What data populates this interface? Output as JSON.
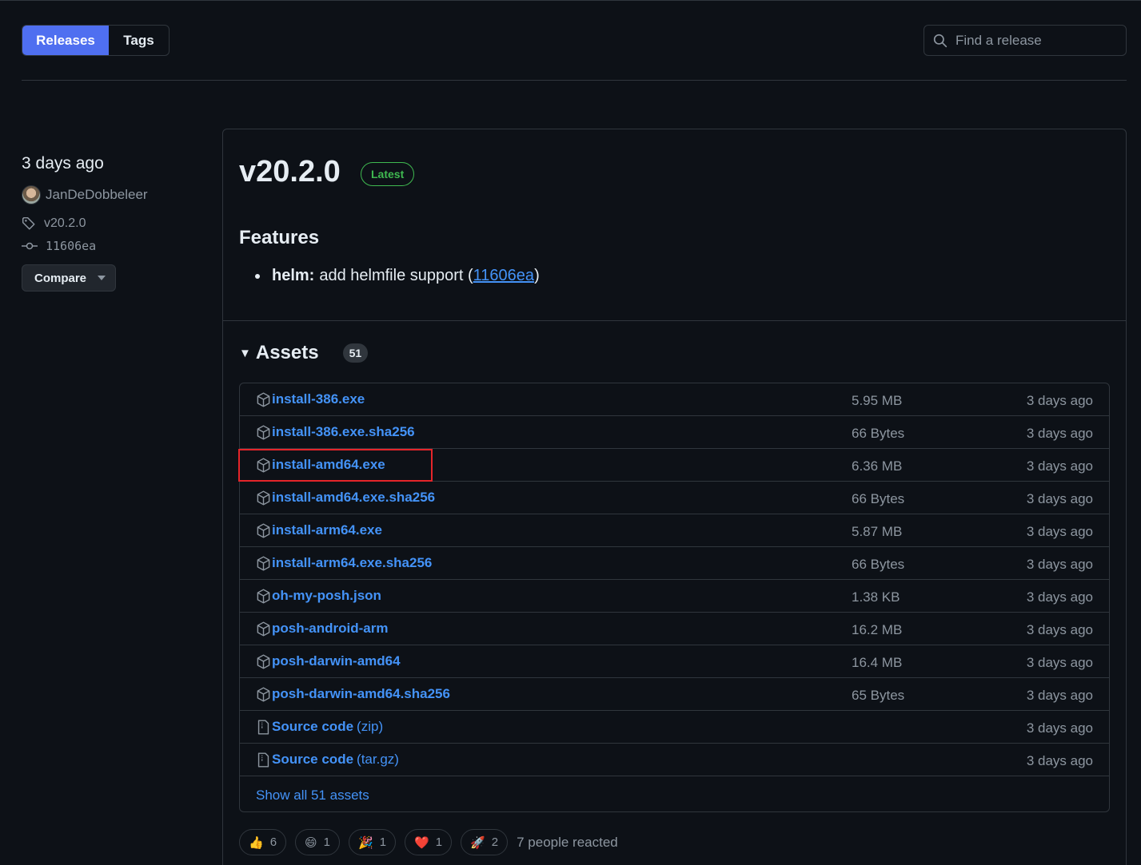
{
  "nav": {
    "releases_label": "Releases",
    "tags_label": "Tags",
    "search_placeholder": "Find a release"
  },
  "meta": {
    "time": "3 days ago",
    "author": "JanDeDobbeleer",
    "tag": "v20.2.0",
    "commit": "11606ea",
    "compare_label": "Compare"
  },
  "release": {
    "title": "v20.2.0",
    "badge": "Latest",
    "features_heading": "Features",
    "feature_scope": "helm:",
    "feature_text": "add helmfile support (",
    "feature_link": "11606ea",
    "feature_close": ")"
  },
  "assets": {
    "heading": "Assets",
    "count": "51",
    "items": [
      {
        "name": "install-386.exe",
        "size": "5.95 MB",
        "time": "3 days ago"
      },
      {
        "name": "install-386.exe.sha256",
        "size": "66 Bytes",
        "time": "3 days ago"
      },
      {
        "name": "install-amd64.exe",
        "size": "6.36 MB",
        "time": "3 days ago"
      },
      {
        "name": "install-amd64.exe.sha256",
        "size": "66 Bytes",
        "time": "3 days ago"
      },
      {
        "name": "install-arm64.exe",
        "size": "5.87 MB",
        "time": "3 days ago"
      },
      {
        "name": "install-arm64.exe.sha256",
        "size": "66 Bytes",
        "time": "3 days ago"
      },
      {
        "name": "oh-my-posh.json",
        "size": "1.38 KB",
        "time": "3 days ago"
      },
      {
        "name": "posh-android-arm",
        "size": "16.2 MB",
        "time": "3 days ago"
      },
      {
        "name": "posh-darwin-amd64",
        "size": "16.4 MB",
        "time": "3 days ago"
      },
      {
        "name": "posh-darwin-amd64.sha256",
        "size": "65 Bytes",
        "time": "3 days ago"
      }
    ],
    "source_zip": {
      "name": "Source code",
      "suffix": "(zip)",
      "time": "3 days ago"
    },
    "source_tar": {
      "name": "Source code",
      "suffix": "(tar.gz)",
      "time": "3 days ago"
    },
    "show_all": "Show all 51 assets"
  },
  "reactions": {
    "items": [
      {
        "emoji": "👍",
        "count": "6"
      },
      {
        "emoji": "😄",
        "count": "1"
      },
      {
        "emoji": "🎉",
        "count": "1"
      },
      {
        "emoji": "❤️",
        "count": "1"
      },
      {
        "emoji": "🚀",
        "count": "2"
      }
    ],
    "summary": "7 people reacted"
  }
}
